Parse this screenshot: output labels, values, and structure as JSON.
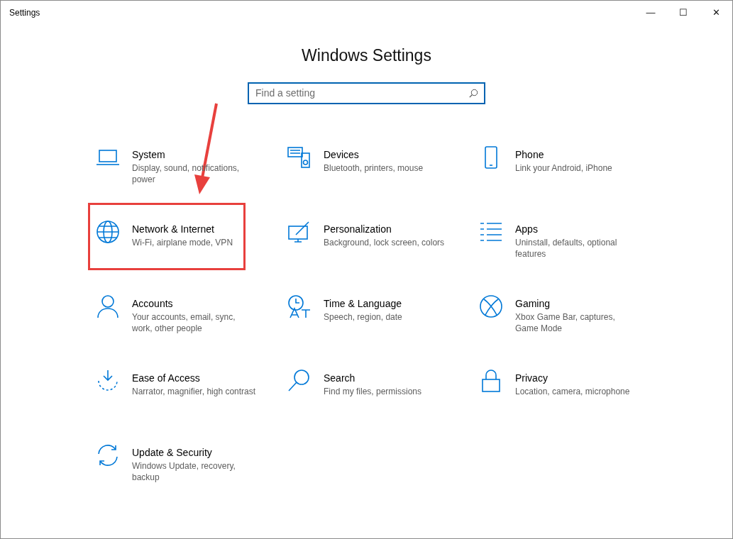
{
  "window": {
    "title": "Settings",
    "controls": [
      "—",
      "☐",
      "✕"
    ]
  },
  "heading": "Windows Settings",
  "search": {
    "placeholder": "Find a setting"
  },
  "tiles": [
    {
      "title": "System",
      "description": "Display, sound, notifications, power",
      "highlighted": false
    },
    {
      "title": "Devices",
      "description": "Bluetooth, printers, mouse",
      "highlighted": false
    },
    {
      "title": "Phone",
      "description": "Link your Android, iPhone",
      "highlighted": false
    },
    {
      "title": "Network & Internet",
      "description": "Wi-Fi, airplane mode, VPN",
      "highlighted": true
    },
    {
      "title": "Personalization",
      "description": "Background, lock screen, colors",
      "highlighted": false
    },
    {
      "title": "Apps",
      "description": "Uninstall, defaults, optional features",
      "highlighted": false
    },
    {
      "title": "Accounts",
      "description": "Your accounts, email, sync, work, other people",
      "highlighted": false
    },
    {
      "title": "Time & Language",
      "description": "Speech, region, date",
      "highlighted": false
    },
    {
      "title": "Gaming",
      "description": "Xbox Game Bar, captures, Game Mode",
      "highlighted": false
    },
    {
      "title": "Ease of Access",
      "description": "Narrator, magnifier, high contrast",
      "highlighted": false
    },
    {
      "title": "Search",
      "description": "Find my files, permissions",
      "highlighted": false
    },
    {
      "title": "Privacy",
      "description": "Location, camera, microphone",
      "highlighted": false
    },
    {
      "title": "Update & Security",
      "description": "Windows Update, recovery, backup",
      "highlighted": false
    }
  ]
}
